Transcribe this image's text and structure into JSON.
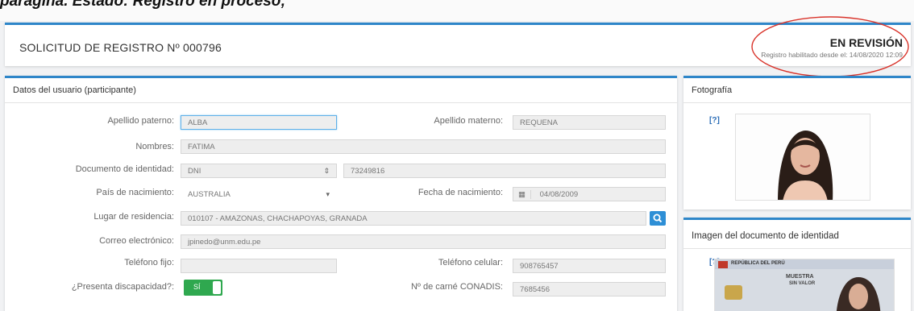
{
  "top_strip": {
    "text": "parágina. Estado: Registro en proceso;"
  },
  "header": {
    "title": "SOLICITUD DE REGISTRO Nº 000796",
    "status": "EN REVISIÓN",
    "status_sub": "Registro habilitado desde el: 14/08/2020 12:09"
  },
  "user_section": {
    "title": "Datos del usuario (participante)",
    "fields": {
      "apellido_paterno": {
        "label": "Apellido paterno:",
        "value": "ALBA"
      },
      "apellido_materno": {
        "label": "Apellido materno:",
        "value": "REQUENA"
      },
      "nombres": {
        "label": "Nombres:",
        "value": "FATIMA"
      },
      "documento": {
        "label": "Documento de identidad:",
        "type": "DNI",
        "number": "73249816"
      },
      "pais": {
        "label": "País de nacimiento:",
        "value": "AUSTRALIA"
      },
      "fecha_nac": {
        "label": "Fecha de nacimiento:",
        "value": "04/08/2009"
      },
      "residencia": {
        "label": "Lugar de residencia:",
        "value": "010107 - AMAZONAS, CHACHAPOYAS, GRANADA"
      },
      "correo": {
        "label": "Correo electrónico:",
        "value": "jpinedo@unm.edu.pe"
      },
      "telefono_fijo": {
        "label": "Teléfono fijo:",
        "value": ""
      },
      "telefono_celular": {
        "label": "Teléfono celular:",
        "value": "908765457"
      },
      "discapacidad": {
        "label": "¿Presenta discapacidad?:",
        "value": "SÍ"
      },
      "conadis": {
        "label": "Nº de carné CONADIS:",
        "value": "7685456"
      }
    }
  },
  "photo_section": {
    "title": "Fotografía",
    "help": "[?]"
  },
  "id_doc_section": {
    "title": "Imagen del documento de identidad",
    "help": "[?]",
    "card_header": "REPÚBLICA DEL PERÚ",
    "card_watermark": "MUESTRA",
    "card_watermark2": "SIN VALOR"
  },
  "colors": {
    "accent": "#2e86c9",
    "annotation": "#d9342b",
    "toggle_on": "#2fa84f"
  }
}
